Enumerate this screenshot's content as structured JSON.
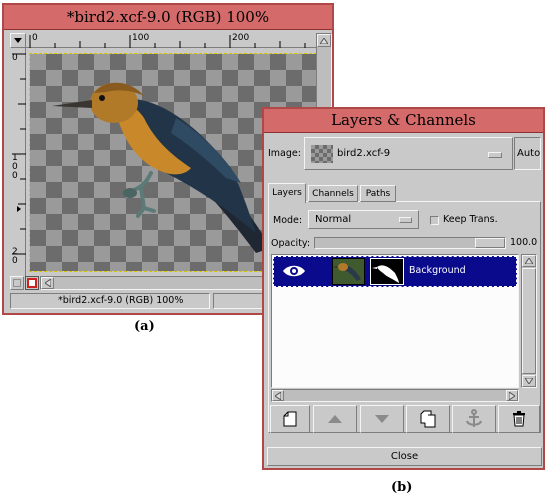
{
  "image_window": {
    "title": "*bird2.xcf-9.0 (RGB) 100%",
    "ruler_top_ticks": [
      "0",
      "100",
      "200"
    ],
    "ruler_left_ticks": [
      "0",
      "1\n0\n0",
      "2\n0"
    ],
    "status_text": "*bird2.xcf-9.0 (RGB) 100%"
  },
  "layers_dialog": {
    "title": "Layers & Channels",
    "image_label": "Image:",
    "image_value": "bird2.xcf-9",
    "auto_label": "Auto",
    "tabs": [
      "Layers",
      "Channels",
      "Paths"
    ],
    "mode_label": "Mode:",
    "mode_value": "Normal",
    "keep_trans_label": "Keep Trans.",
    "opacity_label": "Opacity:",
    "opacity_value": "100.0",
    "layer_name": "Background",
    "close_label": "Close",
    "toolbar_icons": [
      "new-layer-icon",
      "raise-layer-icon",
      "lower-layer-icon",
      "duplicate-layer-icon",
      "anchor-icon",
      "delete-icon"
    ]
  },
  "captions": {
    "a": "(a)",
    "b": "(b)"
  },
  "colors": {
    "title_bar": "#d46a6a",
    "window_border": "#b04848",
    "window_bg": "#c9c9c9",
    "layer_selected": "#0a0a8c"
  }
}
